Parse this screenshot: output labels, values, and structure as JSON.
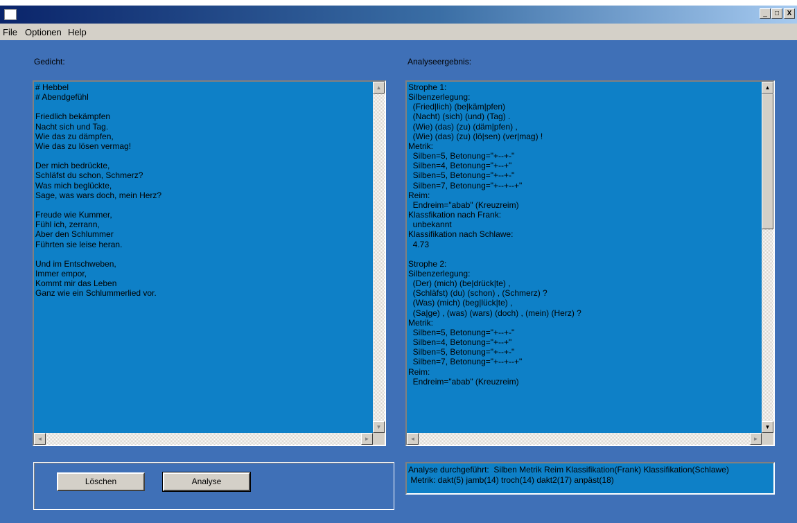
{
  "window": {
    "controls": {
      "minimize": "_",
      "maximize": "□",
      "close": "X"
    }
  },
  "menu": [
    "File",
    "Optionen",
    "Help"
  ],
  "headings": {
    "poem": "Gedicht:",
    "result": "Analyseergebnis:"
  },
  "poem_text": "# Hebbel\n# Abendgefühl\n\nFriedlich bekämpfen\nNacht sich und Tag.\nWie das zu dämpfen,\nWie das zu lösen vermag!\n\nDer mich bedrückte,\nSchläfst du schon, Schmerz?\nWas mich beglückte,\nSage, was wars doch, mein Herz?\n\nFreude wie Kummer,\nFühl ich, zerrann,\nAber den Schlummer\nFührten sie leise heran.\n\nUnd im Entschweben,\nImmer empor,\nKommt mir das Leben\nGanz wie ein Schlummerlied vor.",
  "result_text": "Strophe 1:\nSilbenzerlegung:\n  (Fried|lich) (be|käm|pfen)\n  (Nacht) (sich) (und) (Tag) .\n  (Wie) (das) (zu) (däm|pfen) ,\n  (Wie) (das) (zu) (lö|sen) (ver|mag) !\nMetrik:\n  Silben=5, Betonung=\"+--+-\"\n  Silben=4, Betonung=\"+--+\"\n  Silben=5, Betonung=\"+--+-\"\n  Silben=7, Betonung=\"+--+--+\"\nReim:\n  Endreim=\"abab\" (Kreuzreim)\nKlassfikation nach Frank:\n  unbekannt\nKlassifikation nach Schlawe:\n  4.73\n\nStrophe 2:\nSilbenzerlegung:\n  (Der) (mich) (be|drück|te) ,\n  (Schläfst) (du) (schon) , (Schmerz) ?\n  (Was) (mich) (beg|lück|te) ,\n  (Sa|ge) , (was) (wars) (doch) , (mein) (Herz) ?\nMetrik:\n  Silben=5, Betonung=\"+--+-\"\n  Silben=4, Betonung=\"+--+\"\n  Silben=5, Betonung=\"+--+-\"\n  Silben=7, Betonung=\"+--+--+\"\nReim:\n  Endreim=\"abab\" (Kreuzreim)",
  "buttons": {
    "clear": "Löschen",
    "analyse": "Analyse"
  },
  "status": {
    "line1": "Analyse durchgeführt:  Silben Metrik Reim Klassifikation(Frank) Klassifikation(Schlawe)",
    "line2": " Metrik: dakt(5) jamb(14) troch(14) dakt2(17) anpäst(18)"
  },
  "scroll": {
    "poem_vertical_fraction": 0.0,
    "result_vertical_fraction": 0.0
  },
  "colors": {
    "client_bg": "#3f70b7",
    "panel_bg": "#0e80c7"
  },
  "icons": {
    "up": "▲",
    "down": "▼",
    "left": "◄",
    "right": "►"
  }
}
